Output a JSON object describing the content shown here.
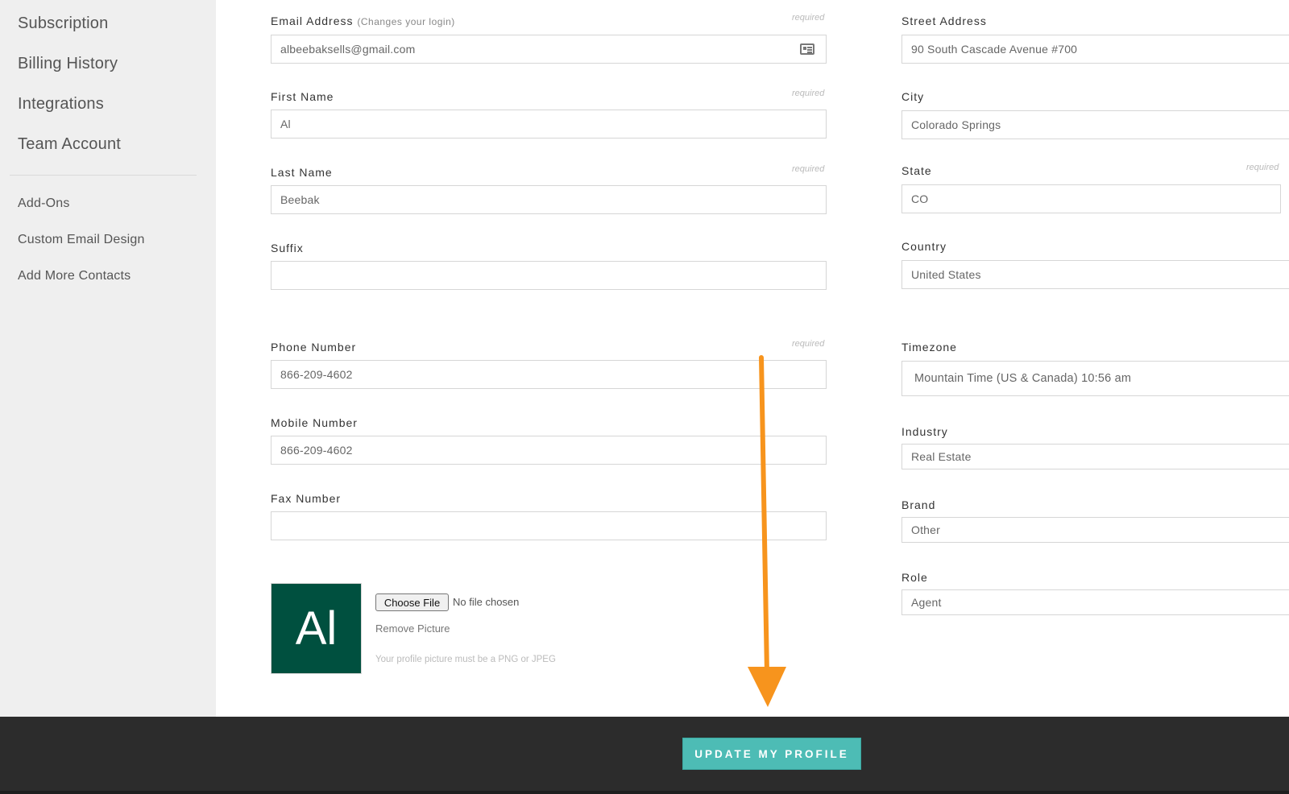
{
  "sidebar": {
    "main_items": [
      {
        "label": "Subscription"
      },
      {
        "label": "Billing History"
      },
      {
        "label": "Integrations"
      },
      {
        "label": "Team Account"
      }
    ],
    "sub_items": [
      {
        "label": "Add-Ons"
      },
      {
        "label": "Custom Email Design"
      },
      {
        "label": "Add More Contacts"
      }
    ]
  },
  "form": {
    "required_text": "required",
    "left": {
      "email": {
        "label": "Email Address",
        "hint": "(Changes your login)",
        "value": "albeebaksells@gmail.com",
        "required": true,
        "icon": "contact-card-icon"
      },
      "first_name": {
        "label": "First Name",
        "value": "Al",
        "required": true
      },
      "last_name": {
        "label": "Last Name",
        "value": "Beebak",
        "required": true
      },
      "suffix": {
        "label": "Suffix",
        "value": ""
      },
      "phone": {
        "label": "Phone Number",
        "value": "866-209-4602",
        "required": true
      },
      "mobile": {
        "label": "Mobile Number",
        "value": "866-209-4602"
      },
      "fax": {
        "label": "Fax Number",
        "value": ""
      }
    },
    "right": {
      "street": {
        "label": "Street Address",
        "value": "90 South Cascade Avenue #700"
      },
      "city": {
        "label": "City",
        "value": "Colorado Springs"
      },
      "state": {
        "label": "State",
        "value": "CO",
        "required": true
      },
      "country": {
        "label": "Country",
        "value": "United States"
      },
      "timezone": {
        "label": "Timezone",
        "value": "Mountain Time (US & Canada) 10:56 am"
      },
      "industry": {
        "label": "Industry",
        "value": "Real Estate"
      },
      "brand": {
        "label": "Brand",
        "value": "Other"
      },
      "role": {
        "label": "Role",
        "value": "Agent"
      }
    }
  },
  "profile_picture": {
    "avatar_initials": "Al",
    "avatar_color": "#00503f",
    "choose_file_label": "Choose File",
    "no_file_text": "No file chosen",
    "remove_label": "Remove Picture",
    "note": "Your profile picture must be a PNG or JPEG"
  },
  "footer": {
    "update_button_label": "UPDATE MY PROFILE",
    "button_color": "#4dbcb5"
  },
  "annotation": {
    "arrow_color": "#f7941d"
  }
}
